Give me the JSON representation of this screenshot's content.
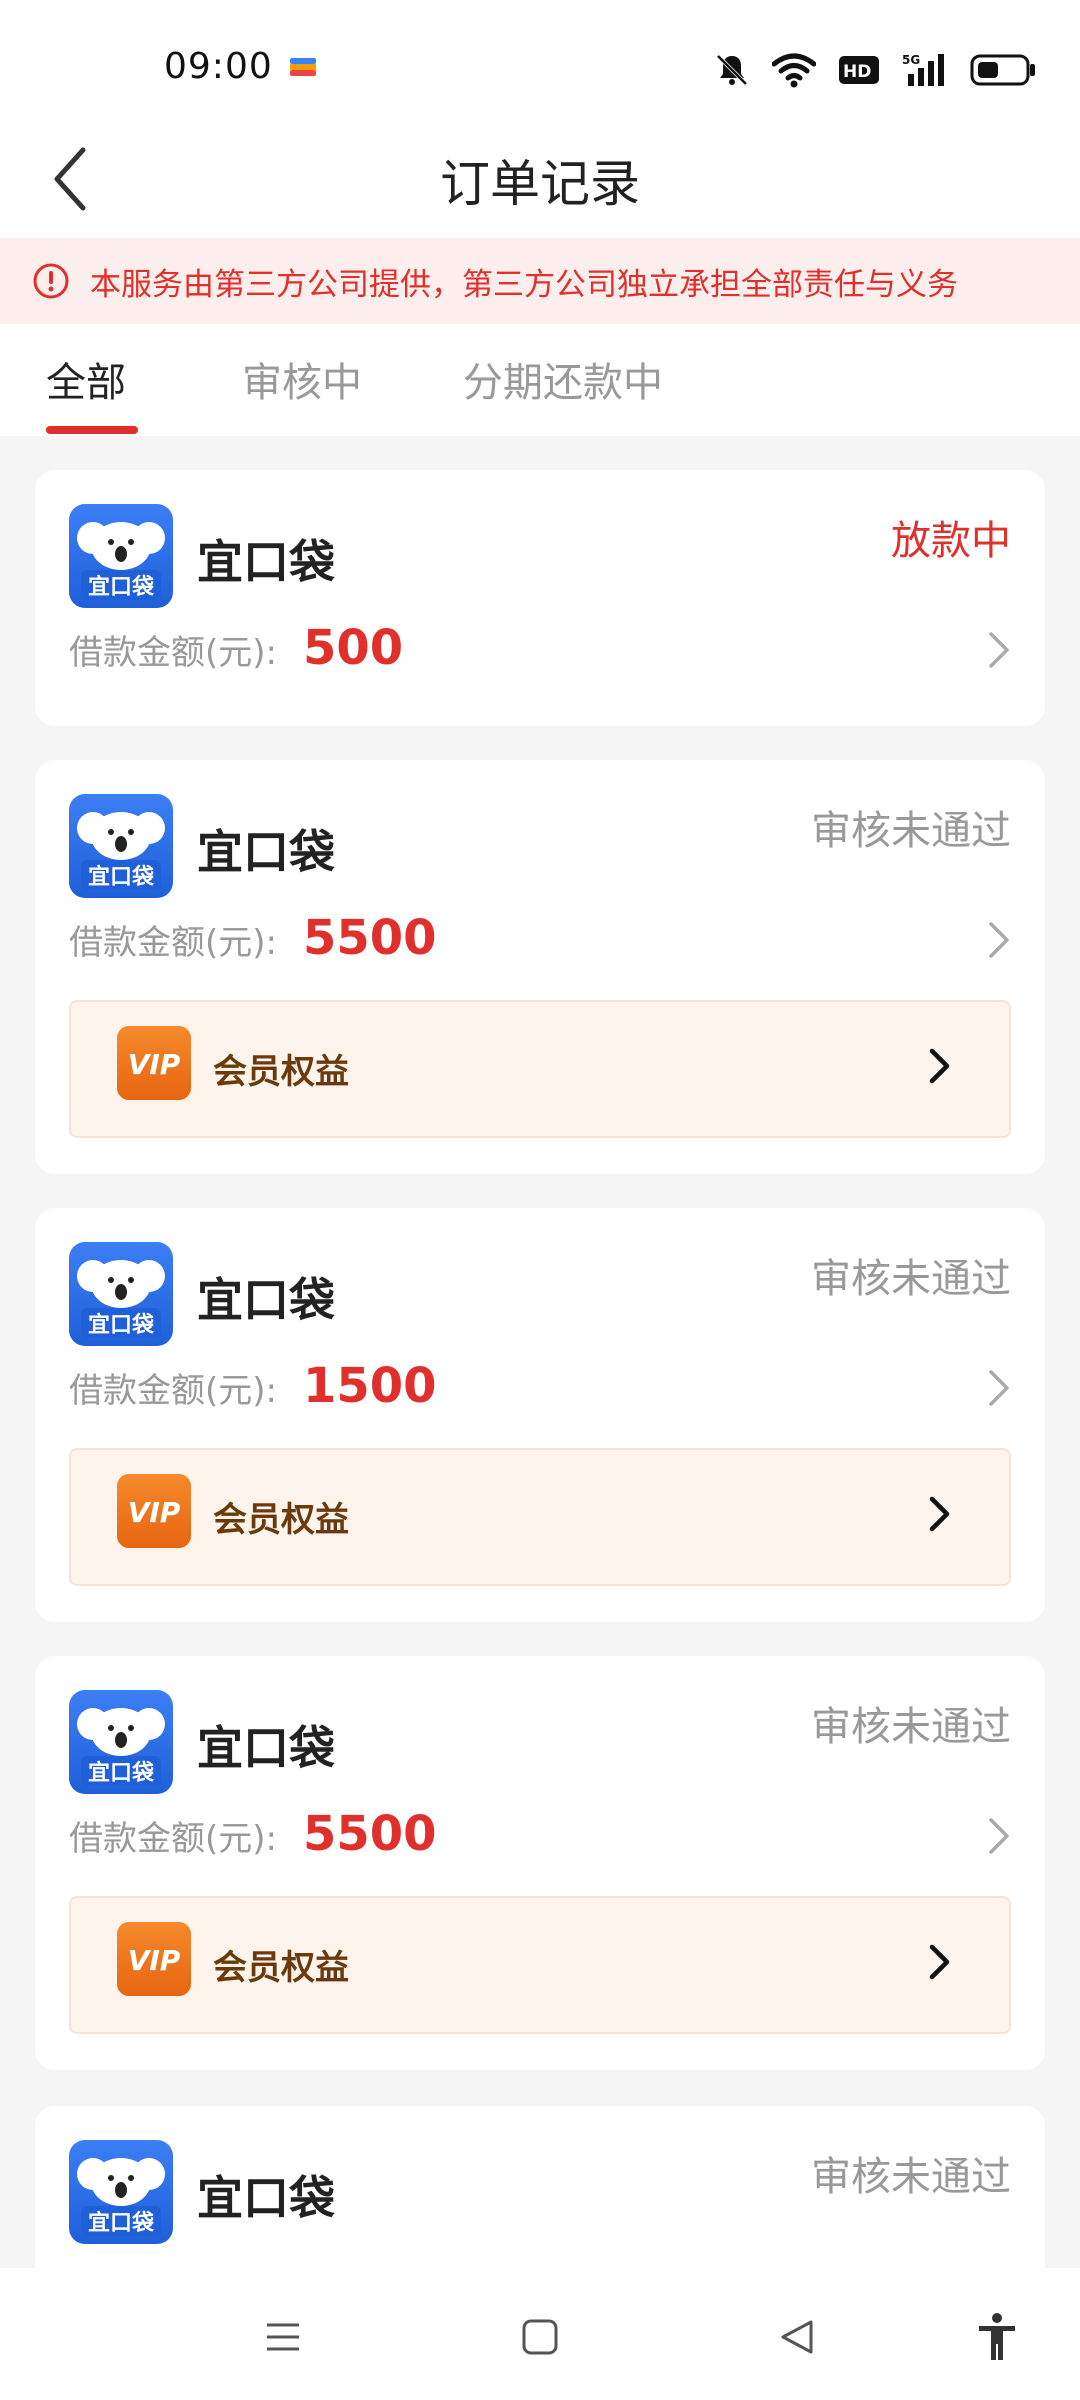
{
  "status_bar": {
    "time": "09:00"
  },
  "header": {
    "title": "订单记录"
  },
  "notice": {
    "text": "本服务由第三方公司提供，第三方公司独立承担全部责任与义务"
  },
  "tabs": [
    {
      "label": "全部",
      "active": true
    },
    {
      "label": "审核中",
      "active": false
    },
    {
      "label": "分期还款中",
      "active": false
    }
  ],
  "orders": [
    {
      "brand": "宜口袋",
      "logo_text": "宜口袋",
      "status": "放款中",
      "status_color": "#e0302b",
      "amount_label": "借款金额(元):",
      "amount": "500",
      "has_vip": false
    },
    {
      "brand": "宜口袋",
      "logo_text": "宜口袋",
      "status": "审核未通过",
      "status_color": "#999999",
      "amount_label": "借款金额(元):",
      "amount": "5500",
      "has_vip": true,
      "vip_label": "会员权益",
      "vip_badge": "VIP"
    },
    {
      "brand": "宜口袋",
      "logo_text": "宜口袋",
      "status": "审核未通过",
      "status_color": "#999999",
      "amount_label": "借款金额(元):",
      "amount": "1500",
      "has_vip": true,
      "vip_label": "会员权益",
      "vip_badge": "VIP"
    },
    {
      "brand": "宜口袋",
      "logo_text": "宜口袋",
      "status": "审核未通过",
      "status_color": "#999999",
      "amount_label": "借款金额(元):",
      "amount": "5500",
      "has_vip": true,
      "vip_label": "会员权益",
      "vip_badge": "VIP"
    },
    {
      "brand": "宜口袋",
      "logo_text": "宜口袋",
      "status": "审核未通过",
      "status_color": "#999999"
    }
  ],
  "icons": {
    "back": "chevron-left-icon",
    "notice": "alert-circle-icon",
    "nav": [
      "menu-icon",
      "home-square-icon",
      "back-triangle-icon",
      "accessibility-icon"
    ]
  },
  "colors": {
    "accent": "#e0302b",
    "vip_bg": "#fff4ec",
    "vip_text": "#6b3a0c",
    "logo_blue": "#2a6ff0"
  }
}
